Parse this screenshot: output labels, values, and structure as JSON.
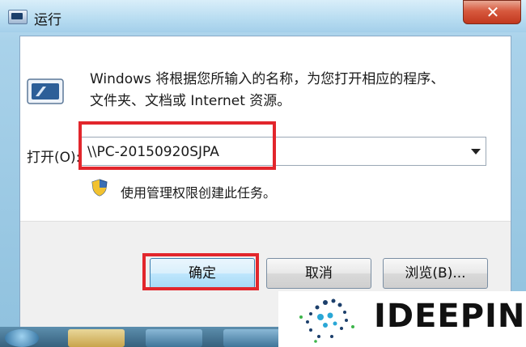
{
  "window": {
    "title": "运行",
    "close_glyph": "✕"
  },
  "dialog": {
    "description_line1": "Windows 将根据您所输入的名称，为您打开相应的程序、",
    "description_line2": "文件夹、文档或 Internet 资源。",
    "open_label": "打开(O):",
    "open_value": "\\\\PC-20150920SJPA",
    "admin_note": "使用管理权限创建此任务。"
  },
  "buttons": {
    "ok": "确定",
    "cancel": "取消",
    "browse": "浏览(B)..."
  },
  "watermark": {
    "text": "IDEEPIN"
  },
  "colors": {
    "highlight": "#e2262c",
    "ok_button_border": "#3c7fb1"
  },
  "icons": {
    "title": "run-icon",
    "close": "close-icon",
    "dropdown": "chevron-down-icon",
    "admin": "shield-icon"
  }
}
